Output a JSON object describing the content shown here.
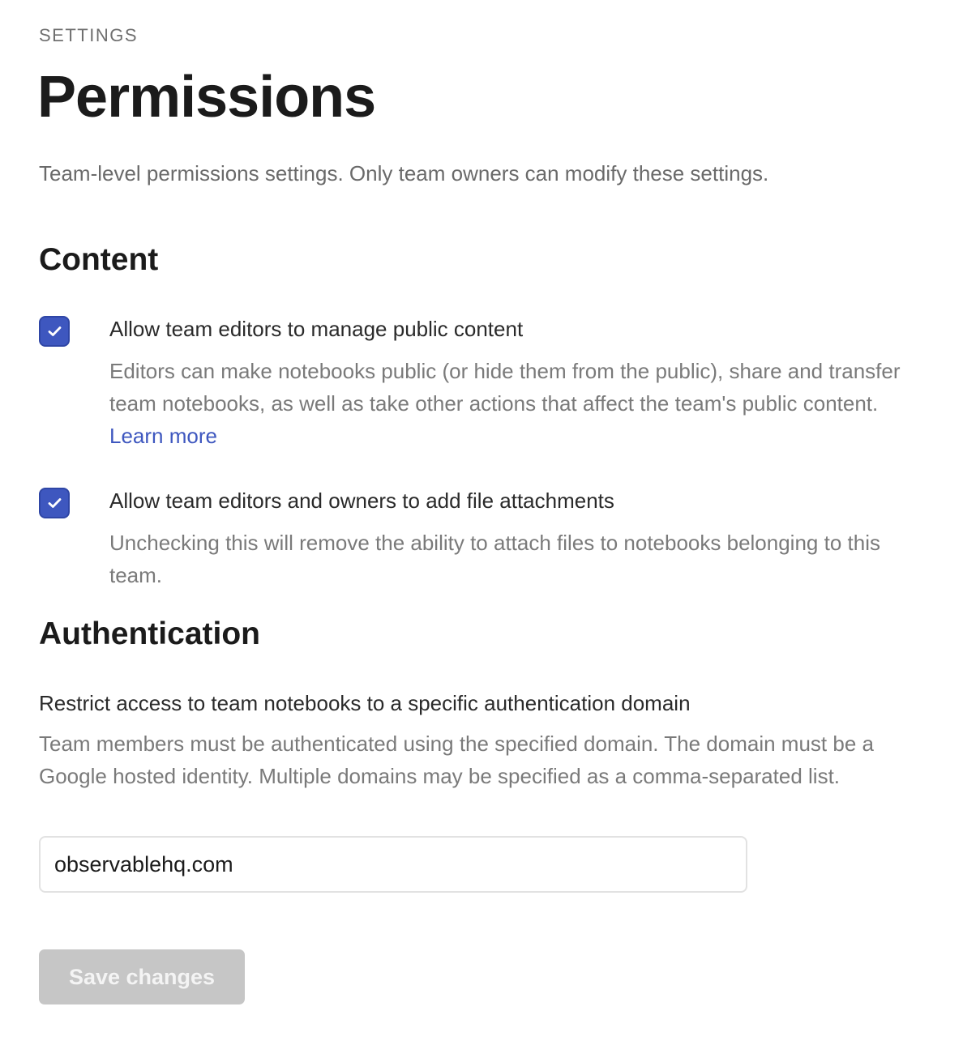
{
  "header": {
    "eyebrow": "SETTINGS",
    "title": "Permissions",
    "description": "Team-level permissions settings. Only team owners can modify these settings."
  },
  "content_section": {
    "title": "Content",
    "options": [
      {
        "checked": true,
        "label": "Allow team editors to manage public content",
        "help": "Editors can make notebooks public (or hide them from the public), share and transfer team notebooks, as well as take other actions that affect the team's public content.",
        "link": "Learn more"
      },
      {
        "checked": true,
        "label": "Allow team editors and owners to add file attachments",
        "help": "Unchecking this will remove the ability to attach files to notebooks belonging to this team."
      }
    ]
  },
  "auth_section": {
    "title": "Authentication",
    "field_label": "Restrict access to team notebooks to a specific authentication domain",
    "field_help": "Team members must be authenticated using the specified domain. The domain must be a Google hosted identity. Multiple domains may be specified as a comma-separated list.",
    "domain_value": "observablehq.com"
  },
  "actions": {
    "save_label": "Save changes"
  },
  "colors": {
    "accent": "#3e57bf",
    "disabled_button": "#c6c6c6",
    "muted_text": "#7a7a7a"
  },
  "icons": {
    "checkbox_mark": "checkmark-icon"
  }
}
